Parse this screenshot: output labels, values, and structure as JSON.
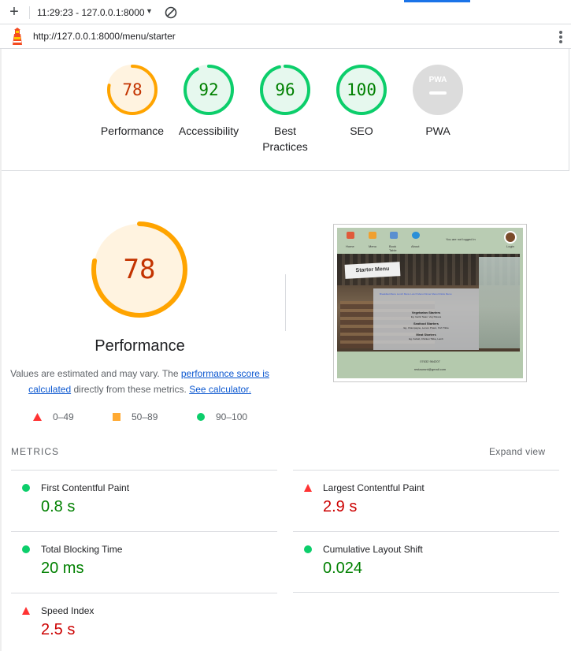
{
  "toolbar": {
    "session": "11:29:23 - 127.0.0.1:8000",
    "add_icon": "plus-icon",
    "caret_icon": "caret-down-icon",
    "clear_icon": "block-icon"
  },
  "urlbar": {
    "url": "http://127.0.0.1:8000/menu/starter",
    "logo_icon": "lighthouse-icon",
    "menu_icon": "kebab-menu-icon"
  },
  "categories": [
    {
      "score": "78",
      "label": "Performance",
      "status": "average",
      "fraction": 0.78
    },
    {
      "score": "92",
      "label": "Accessibility",
      "status": "pass",
      "fraction": 0.92
    },
    {
      "score": "96",
      "label": "Best Practices",
      "status": "pass",
      "fraction": 0.96
    },
    {
      "score": "100",
      "label": "SEO",
      "status": "pass",
      "fraction": 1.0
    },
    {
      "score": "",
      "label": "PWA",
      "status": "na",
      "badge": "PWA"
    }
  ],
  "performance": {
    "score": "78",
    "fraction": 0.78,
    "title": "Performance",
    "note_pre": "Values are estimated and may vary. The ",
    "note_link1": "performance score is calculated",
    "note_mid": " directly from these metrics. ",
    "note_link2": "See calculator."
  },
  "legend": [
    {
      "range": "0–49",
      "shape": "triangle",
      "color": "#ff3333"
    },
    {
      "range": "50–89",
      "shape": "square",
      "color": "#ffaa33"
    },
    {
      "range": "90–100",
      "shape": "circle",
      "color": "#0cce6b"
    }
  ],
  "thumbnail": {
    "nav": [
      "Home",
      "Menu",
      "Book Table",
      "About"
    ],
    "not_logged": "You are not logged in",
    "login": "Login",
    "badge": "Starter Menu",
    "links": "Breakfast Menu   Lunch Menu   Lunch Menu   Dinner Menu   Drinks Menu",
    "lines": [
      "Vegetarian Starters",
      "Eg. Garlic Naan, Veg Pakora",
      "Seafood Starters",
      "Eg. Champagne, Lemon Prawn, Fish Tikka",
      "Meat Starters",
      "Eg. Kebab, Chicken Tikka, Lamb"
    ],
    "footer": [
      "07632 964207",
      "restaurant@gmail.com"
    ]
  },
  "metrics": {
    "heading": "METRICS",
    "expand": "Expand view",
    "items": [
      {
        "name": "First Contentful Paint",
        "value": "0.8 s",
        "status": "pass"
      },
      {
        "name": "Largest Contentful Paint",
        "value": "2.9 s",
        "status": "fail"
      },
      {
        "name": "Total Blocking Time",
        "value": "20 ms",
        "status": "pass"
      },
      {
        "name": "Cumulative Layout Shift",
        "value": "0.024",
        "status": "pass"
      },
      {
        "name": "Speed Index",
        "value": "2.5 s",
        "status": "fail"
      }
    ]
  },
  "colors": {
    "pass": "#0cce6b",
    "average": "#ffa400",
    "fail": "#ff3333",
    "pass_text": "#008000",
    "average_text": "#c33300",
    "fail_text": "#cc0000",
    "accent": "#1a73e8"
  }
}
